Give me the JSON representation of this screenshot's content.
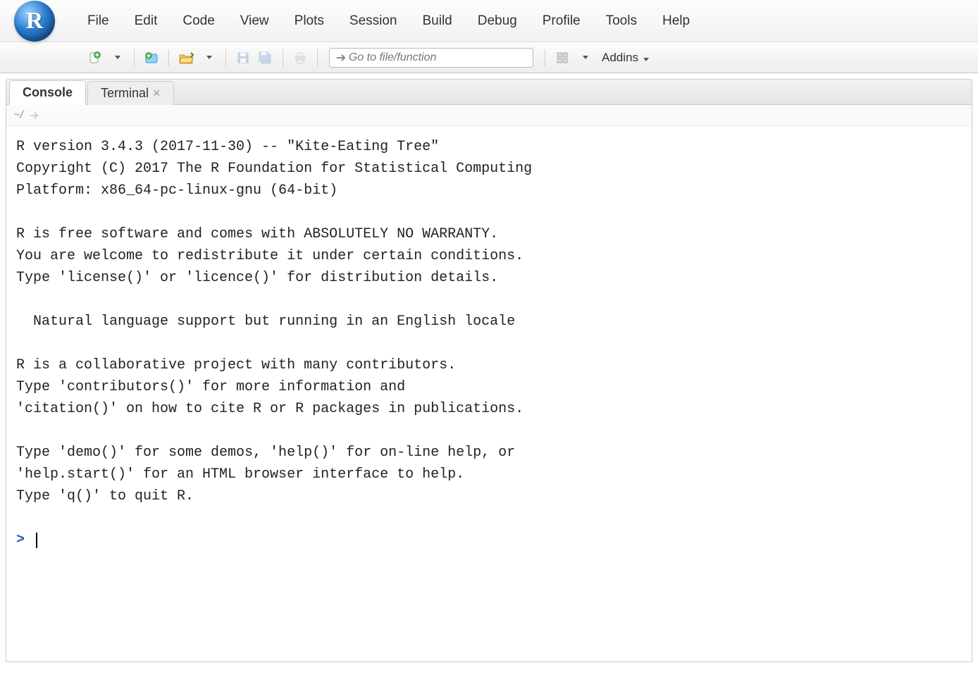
{
  "logo_letter": "R",
  "menu": {
    "items": [
      "File",
      "Edit",
      "Code",
      "View",
      "Plots",
      "Session",
      "Build",
      "Debug",
      "Profile",
      "Tools",
      "Help"
    ]
  },
  "toolbar": {
    "goto_placeholder": "Go to file/function",
    "addins_label": "Addins"
  },
  "tabs": {
    "console": "Console",
    "terminal": "Terminal"
  },
  "pathbar": {
    "path": "~/"
  },
  "console": {
    "lines": [
      "R version 3.4.3 (2017-11-30) -- \"Kite-Eating Tree\"",
      "Copyright (C) 2017 The R Foundation for Statistical Computing",
      "Platform: x86_64-pc-linux-gnu (64-bit)",
      "",
      "R is free software and comes with ABSOLUTELY NO WARRANTY.",
      "You are welcome to redistribute it under certain conditions.",
      "Type 'license()' or 'licence()' for distribution details.",
      "",
      "  Natural language support but running in an English locale",
      "",
      "R is a collaborative project with many contributors.",
      "Type 'contributors()' for more information and",
      "'citation()' on how to cite R or R packages in publications.",
      "",
      "Type 'demo()' for some demos, 'help()' for on-line help, or",
      "'help.start()' for an HTML browser interface to help.",
      "Type 'q()' to quit R.",
      ""
    ],
    "prompt": ">"
  }
}
